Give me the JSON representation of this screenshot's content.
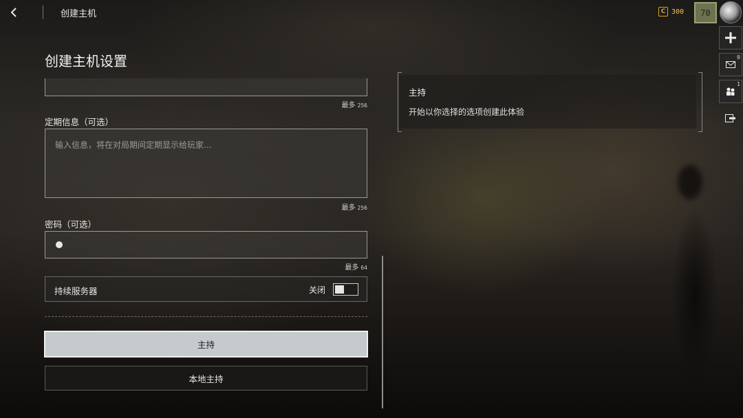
{
  "topbar": {
    "back_icon": "chevron-left-icon",
    "title": "创建主机",
    "currency_icon_glyph": "C",
    "currency_value": "300",
    "level": "70"
  },
  "rail": {
    "add_icon": "plus-icon",
    "mail_count": "0",
    "friends_count": "1"
  },
  "page": {
    "title": "创建主机设置"
  },
  "fields": {
    "first_max_label": "最多",
    "first_max_value": "256",
    "message_label": "定期信息（可选）",
    "message_placeholder": "输入信息，将在对局期间定期显示给玩家...",
    "message_max_label": "最多",
    "message_max_value": "256",
    "password_label": "密码（可选）",
    "password_max_label": "最多",
    "password_max_value": "64"
  },
  "persistent": {
    "label": "持续服务器",
    "state": "关闭",
    "enabled": false
  },
  "buttons": {
    "host": "主持",
    "local_host": "本地主持"
  },
  "info": {
    "title": "主持",
    "description": "开始以你选择的选项创建此体验"
  },
  "colors": {
    "currency": "#d9a12a",
    "level_badge": "#6d7350",
    "primary_button": "#c5cacd"
  }
}
